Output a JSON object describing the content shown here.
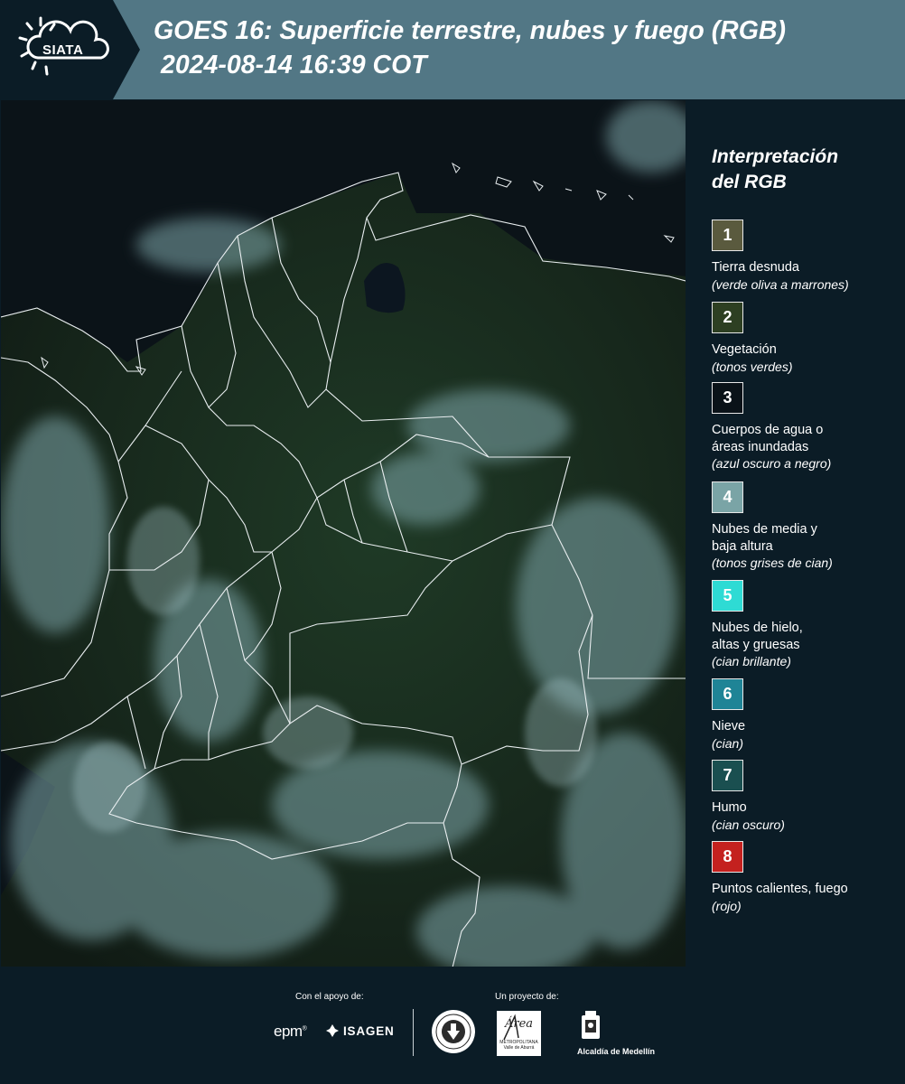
{
  "header": {
    "logo_text": "SIATA",
    "title": "GOES 16: Superficie terrestre, nubes y fuego (RGB)",
    "timestamp": "2024-08-14 16:39 COT"
  },
  "legend": {
    "title_line1": "Interpretación",
    "title_line2": "del RGB",
    "items": [
      {
        "number": "1",
        "name": "Tierra desnuda",
        "note": "(verde oliva a marrones)",
        "color": "#5a5a3e"
      },
      {
        "number": "2",
        "name": "Vegetación",
        "note": "(tonos verdes)",
        "color": "#2d3f22"
      },
      {
        "number": "3",
        "name": "Cuerpos de agua o\náreas inundadas",
        "note": "(azul oscuro a negro)",
        "color": "#0a1218"
      },
      {
        "number": "4",
        "name": "Nubes de media y\nbaja altura",
        "note": "(tonos grises de cian)",
        "color": "#7aa4a6"
      },
      {
        "number": "5",
        "name": "Nubes de hielo,\naltas y gruesas",
        "note": "(cian brillante)",
        "color": "#2edbd4"
      },
      {
        "number": "6",
        "name": "Nieve",
        "note": "(cian)",
        "color": "#1f8496"
      },
      {
        "number": "7",
        "name": "Humo",
        "note": "(cian oscuro)",
        "color": "#1a4f50"
      },
      {
        "number": "8",
        "name": "Puntos calientes, fuego",
        "note": "(rojo)",
        "color": "#c4211f"
      }
    ]
  },
  "footer": {
    "support_label": "Con el apoyo de:",
    "project_label": "Un proyecto de:",
    "sponsor1": "epm",
    "sponsor2": "ISAGEN",
    "partner_area": "Área",
    "partner_area_sub": "METROPOLITANA Valle de Aburrá",
    "partner_alcaldia": "Alcaldía de Medellín"
  }
}
